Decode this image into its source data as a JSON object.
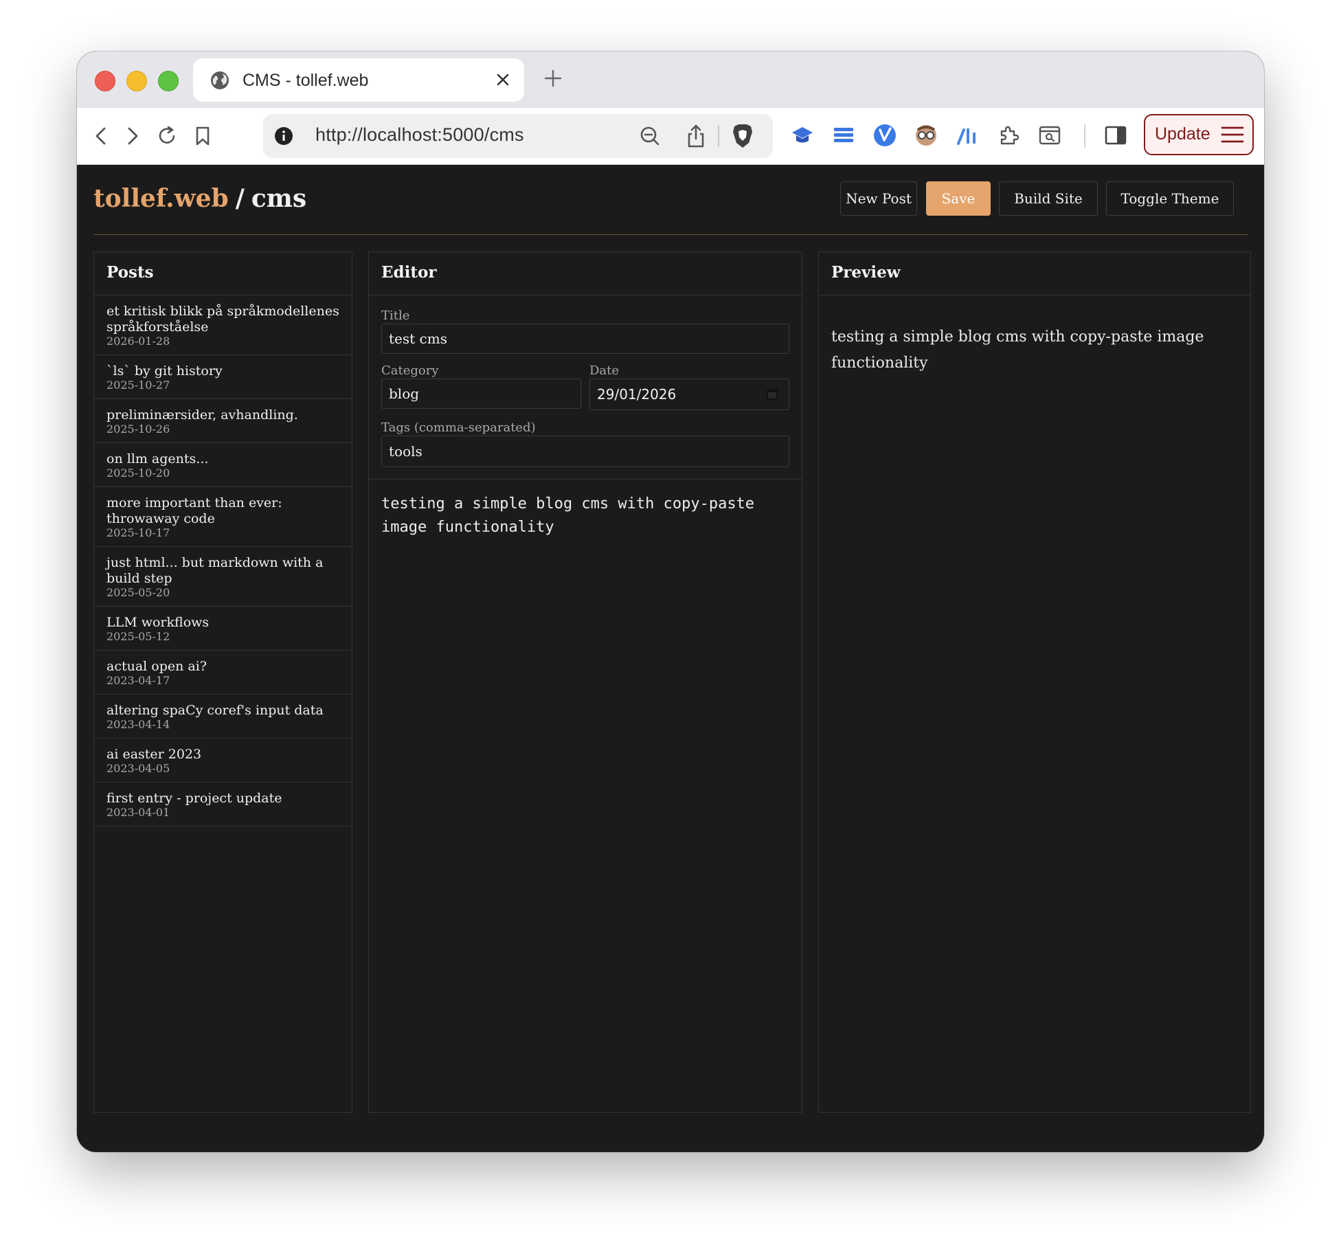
{
  "browser": {
    "tab_title": "CMS - tollef.web",
    "url": "http://localhost:5000/cms",
    "update_label": "Update"
  },
  "header": {
    "brand_site": "tollef.web",
    "brand_sep": "/",
    "brand_section": "cms",
    "buttons": {
      "new_post": "New Post",
      "save": "Save",
      "build_site": "Build Site",
      "toggle_theme": "Toggle Theme"
    },
    "accent_color": "#e5a46b"
  },
  "posts": {
    "heading": "Posts",
    "items": [
      {
        "title": "et kritisk blikk på språkmodellenes språkforståelse",
        "date": "2026-01-28"
      },
      {
        "title": "`ls` by git history",
        "date": "2025-10-27"
      },
      {
        "title": "preliminærsider, avhandling.",
        "date": "2025-10-26"
      },
      {
        "title": "on llm agents...",
        "date": "2025-10-20"
      },
      {
        "title": "more important than ever: throwaway code",
        "date": "2025-10-17"
      },
      {
        "title": "just html... but markdown with a build step",
        "date": "2025-05-20"
      },
      {
        "title": "LLM workflows",
        "date": "2025-05-12"
      },
      {
        "title": "actual open ai?",
        "date": "2023-04-17"
      },
      {
        "title": "altering spaCy coref's input data",
        "date": "2023-04-14"
      },
      {
        "title": "ai easter 2023",
        "date": "2023-04-05"
      },
      {
        "title": "first entry - project update",
        "date": "2023-04-01"
      }
    ]
  },
  "editor": {
    "heading": "Editor",
    "title_label": "Title",
    "title_value": "test cms",
    "category_label": "Category",
    "category_value": "blog",
    "date_label": "Date",
    "date_value": "29/01/2026",
    "tags_label": "Tags (comma-separated)",
    "tags_value": "tools",
    "body": "testing a simple blog cms with copy-paste\nimage functionality"
  },
  "preview": {
    "heading": "Preview",
    "body": "testing a simple blog cms with copy-paste image functionality"
  }
}
